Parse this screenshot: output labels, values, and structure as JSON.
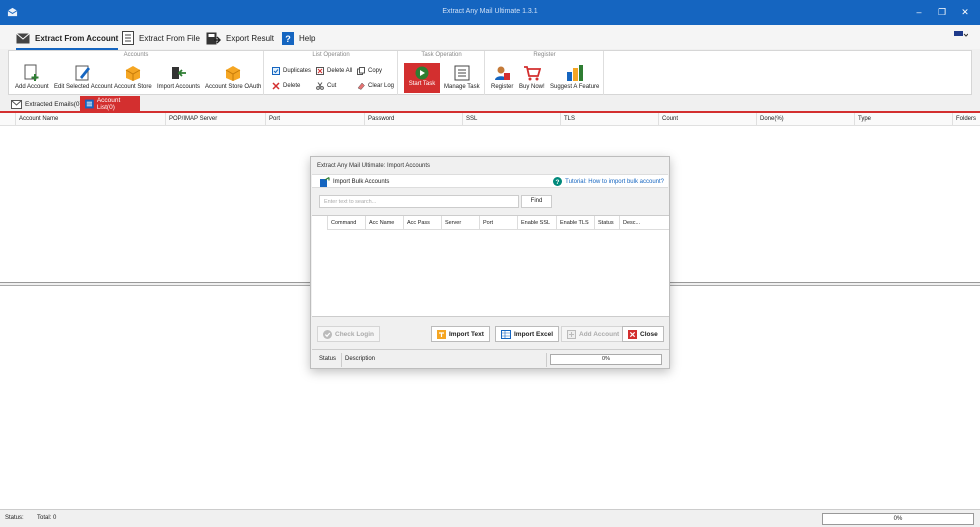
{
  "window": {
    "title": "Extract Any Mail Ultimate 1.3.1"
  },
  "menu": {
    "items": [
      {
        "label": "Extract From Account",
        "active": true
      },
      {
        "label": "Extract From File"
      },
      {
        "label": "Export Result"
      },
      {
        "label": "Help"
      }
    ]
  },
  "ribbon": {
    "accounts": {
      "title": "Accounts",
      "add": "Add Account",
      "edit": "Edit Selected Account",
      "store": "Account Store",
      "import": "Import Accounts",
      "store_oauth": "Account Store OAuth"
    },
    "list": {
      "title": "List Operation",
      "duplicates": "Duplicates",
      "delete_all": "Delete All",
      "copy": "Copy",
      "delete": "Delete",
      "cut": "Cut",
      "clear_log": "Clear Log"
    },
    "task": {
      "title": "Task Operation",
      "start": "Start Task",
      "manage": "Manage Task"
    },
    "register": {
      "title": "Register",
      "register": "Register",
      "buy": "Buy Now!",
      "suggest": "Suggest A Feature"
    }
  },
  "tabs": [
    {
      "label": "Extracted Emails(0)"
    },
    {
      "label": "Account List(0)",
      "selected": true
    }
  ],
  "grid": {
    "columns": [
      "Account Name",
      "POP/IMAP Server",
      "Port",
      "Password",
      "SSL",
      "TLS",
      "Count",
      "Done(%)",
      "Type",
      "Folders"
    ]
  },
  "status": {
    "status_label": "Status:",
    "total_label": "Total: 0",
    "progress": "0%"
  },
  "dialog": {
    "title": "Extract Any Mail Ultimate: Import Accounts",
    "subtitle": "Import Bulk Accounts",
    "tutorial": "Tutorial: How to import bulk account?",
    "search_placeholder": "Enter text to search...",
    "find": "Find",
    "columns": [
      "Command",
      "Acc Name",
      "Acc Pass",
      "Server",
      "Port",
      "Enable SSL",
      "Enable TLS",
      "Status",
      "Desc..."
    ],
    "buttons": {
      "check_login": "Check Login",
      "import_text": "Import Text",
      "import_excel": "Import Excel",
      "add_account": "Add Account",
      "close": "Close"
    },
    "status_label": "Status",
    "description_label": "Description",
    "progress": "0%"
  },
  "colors": {
    "brand_blue": "#1565c0",
    "accent_red": "#d32f2f"
  }
}
